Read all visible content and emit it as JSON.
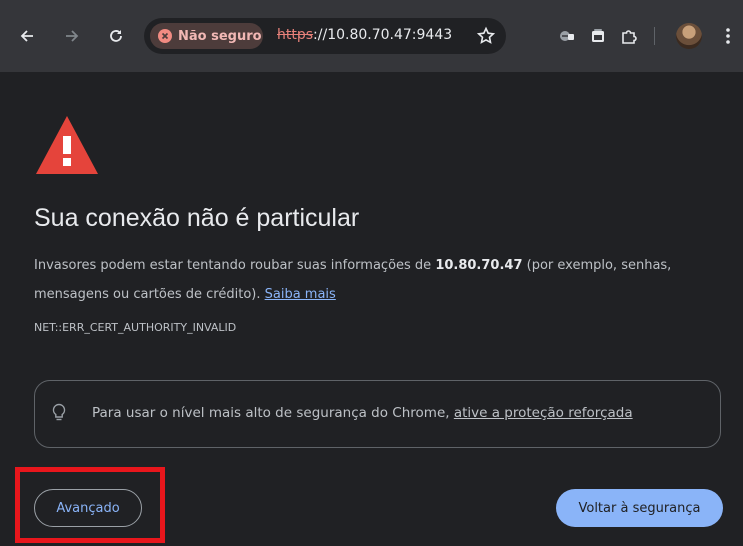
{
  "toolbar": {
    "security_chip_label": "Não seguro",
    "url_scheme": "https",
    "url_rest": "://10.80.70.47:9443",
    "icons": [
      "back-arrow-icon",
      "forward-arrow-icon",
      "reload-icon",
      "bookmark-star-icon",
      "extension-icon",
      "tab-media-icon",
      "extensions-puzzle-icon",
      "profile-avatar",
      "menu-kebab-icon"
    ]
  },
  "interstitial": {
    "title": "Sua conexão não é particular",
    "body_prefix": "Invasores podem estar tentando roubar suas informações de ",
    "host": "10.80.70.47",
    "body_suffix": " (por exemplo, senhas, mensagens ou cartões de crédito). ",
    "learn_more": "Saiba mais",
    "error_code": "NET::ERR_CERT_AUTHORITY_INVALID",
    "enhanced_text": "Para usar o nível mais alto de segurança do Chrome, ",
    "enhanced_link": "ative a proteção reforçada",
    "advanced_button": "Avançado",
    "back_button": "Voltar à segurança"
  },
  "colors": {
    "page_background": "#202124",
    "toolbar_background": "#35363a",
    "warning_red": "#e5443b",
    "link_blue": "#8ab4f8",
    "highlight_red": "#e8161c"
  }
}
